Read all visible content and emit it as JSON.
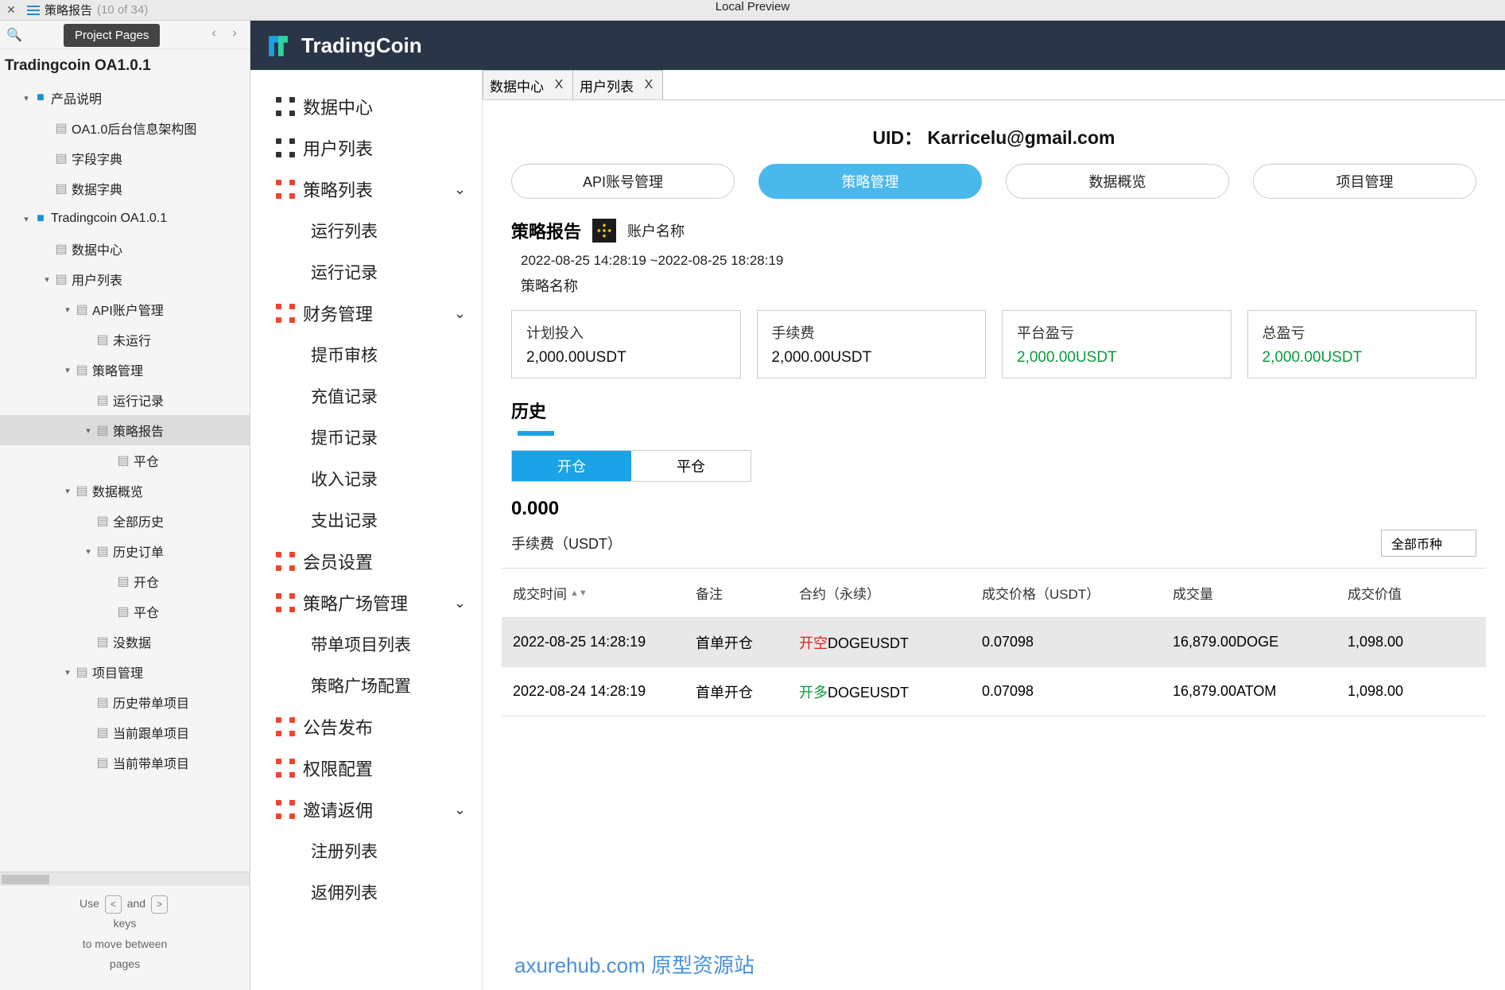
{
  "topbar": {
    "crumb": "策略报告",
    "count": "(10 of 34)",
    "preview": "Local Preview",
    "tooltip": "Project Pages"
  },
  "project": {
    "title": "Tradingcoin OA1.0.1"
  },
  "tree": [
    {
      "lvl": 0,
      "caret": "▾",
      "type": "folder",
      "label": "产品说明"
    },
    {
      "lvl": 1,
      "caret": "",
      "type": "page",
      "label": "OA1.0后台信息架构图"
    },
    {
      "lvl": 1,
      "caret": "",
      "type": "page",
      "label": "字段字典"
    },
    {
      "lvl": 1,
      "caret": "",
      "type": "page",
      "label": "数据字典"
    },
    {
      "lvl": 0,
      "caret": "▾",
      "type": "folder",
      "label": "Tradingcoin OA1.0.1"
    },
    {
      "lvl": 1,
      "caret": "",
      "type": "page",
      "label": "数据中心"
    },
    {
      "lvl": 1,
      "caret": "▾",
      "type": "page",
      "label": "用户列表"
    },
    {
      "lvl": 2,
      "caret": "▾",
      "type": "page",
      "label": "API账户管理"
    },
    {
      "lvl": 3,
      "caret": "",
      "type": "page",
      "label": "未运行"
    },
    {
      "lvl": 2,
      "caret": "▾",
      "type": "page",
      "label": "策略管理"
    },
    {
      "lvl": 3,
      "caret": "",
      "type": "page",
      "label": "运行记录"
    },
    {
      "lvl": 3,
      "caret": "▾",
      "type": "page",
      "label": "策略报告",
      "sel": true
    },
    {
      "lvl": 4,
      "caret": "",
      "type": "page",
      "label": "平仓"
    },
    {
      "lvl": 2,
      "caret": "▾",
      "type": "page",
      "label": "数据概览"
    },
    {
      "lvl": 3,
      "caret": "",
      "type": "page",
      "label": "全部历史"
    },
    {
      "lvl": 3,
      "caret": "▾",
      "type": "page",
      "label": "历史订单"
    },
    {
      "lvl": 4,
      "caret": "",
      "type": "page",
      "label": "开仓"
    },
    {
      "lvl": 4,
      "caret": "",
      "type": "page",
      "label": "平仓"
    },
    {
      "lvl": 3,
      "caret": "",
      "type": "page",
      "label": "没数据"
    },
    {
      "lvl": 2,
      "caret": "▾",
      "type": "page",
      "label": "项目管理"
    },
    {
      "lvl": 3,
      "caret": "",
      "type": "page",
      "label": "历史带单项目"
    },
    {
      "lvl": 3,
      "caret": "",
      "type": "page",
      "label": "当前跟单项目"
    },
    {
      "lvl": 3,
      "caret": "",
      "type": "page",
      "label": "当前带单项目"
    }
  ],
  "hint": {
    "l1": "Use",
    "l2": "and",
    "l3": "keys",
    "l4": "to move between",
    "l5": "pages",
    "k1": "<",
    "k2": ">"
  },
  "brand": "TradingCoin",
  "nav": [
    {
      "type": "top",
      "color": "plain",
      "label": "数据中心"
    },
    {
      "type": "top",
      "color": "plain",
      "label": "用户列表"
    },
    {
      "type": "top",
      "color": "red",
      "label": "策略列表",
      "chev": true
    },
    {
      "type": "sub",
      "label": "运行列表"
    },
    {
      "type": "sub",
      "label": "运行记录"
    },
    {
      "type": "top",
      "color": "red",
      "label": "财务管理",
      "chev": true
    },
    {
      "type": "sub",
      "label": "提币审核"
    },
    {
      "type": "sub",
      "label": "充值记录"
    },
    {
      "type": "sub",
      "label": "提币记录"
    },
    {
      "type": "sub",
      "label": "收入记录"
    },
    {
      "type": "sub",
      "label": "支出记录"
    },
    {
      "type": "top",
      "color": "red",
      "label": "会员设置"
    },
    {
      "type": "top",
      "color": "red",
      "label": "策略广场管理",
      "chev": true
    },
    {
      "type": "sub",
      "label": "带单项目列表"
    },
    {
      "type": "sub",
      "label": "策略广场配置"
    },
    {
      "type": "top",
      "color": "red",
      "label": "公告发布"
    },
    {
      "type": "top",
      "color": "red",
      "label": "权限配置"
    },
    {
      "type": "top",
      "color": "red",
      "label": "邀请返佣",
      "chev": true
    },
    {
      "type": "sub",
      "label": "注册列表"
    },
    {
      "type": "sub",
      "label": "返佣列表"
    }
  ],
  "tabs": [
    {
      "label": "数据中心",
      "x": "X"
    },
    {
      "label": "用户列表",
      "x": "X"
    }
  ],
  "uid": "UID： Karricelu@gmail.com",
  "pills": [
    {
      "label": "API账号管理"
    },
    {
      "label": "策略管理",
      "act": true
    },
    {
      "label": "数据概览"
    },
    {
      "label": "项目管理"
    }
  ],
  "report": {
    "title": "策略报告",
    "account": "账户名称",
    "range": "2022-08-25 14:28:19 ~2022-08-25 18:28:19",
    "stname": "策略名称"
  },
  "cards": [
    {
      "lbl": "计划投入",
      "val": "2,000.00USDT"
    },
    {
      "lbl": "手续费",
      "val": "2,000.00USDT"
    },
    {
      "lbl": "平台盈亏",
      "val": "2,000.00USDT",
      "grn": true
    },
    {
      "lbl": "总盈亏",
      "val": "2,000.00USDT",
      "grn": true
    }
  ],
  "history": {
    "title": "历史",
    "tg1": "开仓",
    "tg2": "平仓",
    "zero": "0.000",
    "feelabel": "手续费（USDT）",
    "sel": "全部币种"
  },
  "thead": {
    "time": "成交时间",
    "note": "备注",
    "ctr": "合约（永续）",
    "px": "成交价格（USDT）",
    "vol": "成交量",
    "amt": "成交价值"
  },
  "rows": [
    {
      "time": "2022-08-25 14:28:19",
      "note": "首单开仓",
      "side": "开空",
      "sidecls": "red",
      "pair": "DOGEUSDT",
      "px": "0.07098",
      "vol": "16,879.00DOGE",
      "amt": "1,098.00",
      "hov": true
    },
    {
      "time": "2022-08-24 14:28:19",
      "note": "首单开仓",
      "side": "开多",
      "sidecls": "grn",
      "pair": "DOGEUSDT",
      "px": "0.07098",
      "vol": "16,879.00ATOM",
      "amt": "1,098.00"
    }
  ],
  "wm": "axurehub.com 原型资源站"
}
